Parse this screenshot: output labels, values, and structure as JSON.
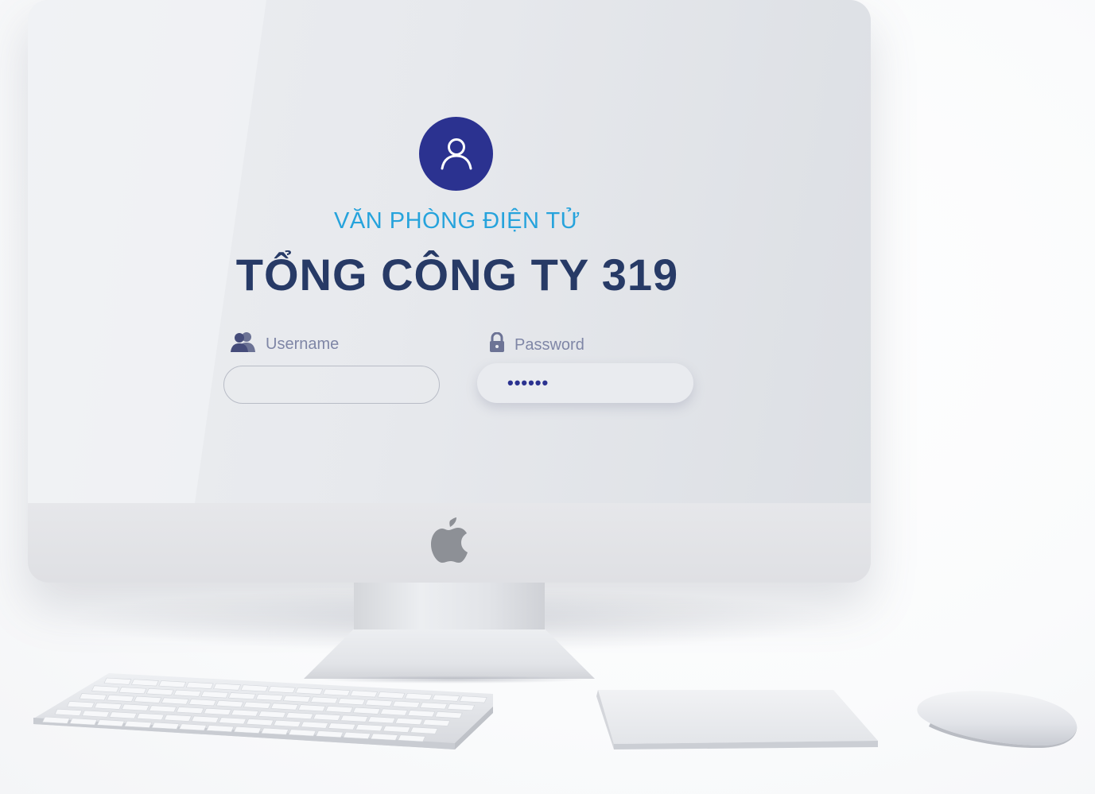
{
  "login": {
    "subtitle": "VĂN PHÒNG ĐIỆN TỬ",
    "title": "TỔNG CÔNG TY 319",
    "username": {
      "label": "Username",
      "value": "",
      "icon": "users-icon"
    },
    "password": {
      "label": "Password",
      "value": "••••••",
      "icon": "lock-icon"
    },
    "avatar_icon": "user-icon"
  },
  "colors": {
    "accent": "#2b3290",
    "subtitle": "#26a3dc",
    "title": "#273a66",
    "label": "#7f86a6"
  }
}
